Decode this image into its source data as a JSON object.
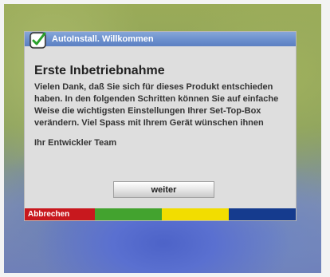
{
  "dialog": {
    "title": "AutoInstall. Willkommen",
    "heading": "Erste Inbetriebnahme",
    "body": "Vielen Dank, daß Sie sich für dieses Produkt entschieden haben. In den folgenden Schritten können Sie auf einfache Weise die wichtigsten Einstellungen Ihrer Set-Top-Box verändern. Viel Spass mit Ihrem Gerät wünschen ihnen",
    "signature": "Ihr Entwickler Team",
    "next_label": "weiter"
  },
  "colorbar": {
    "red_label": "Abbrechen",
    "colors": {
      "red": "#c8181e",
      "green": "#43a32f",
      "yellow": "#f2dd00",
      "blue": "#153b8e"
    }
  },
  "icons": {
    "title": "check-icon"
  },
  "colors": {
    "titlebar": "#6b8fcd",
    "dialog_bg": "#dedede"
  }
}
